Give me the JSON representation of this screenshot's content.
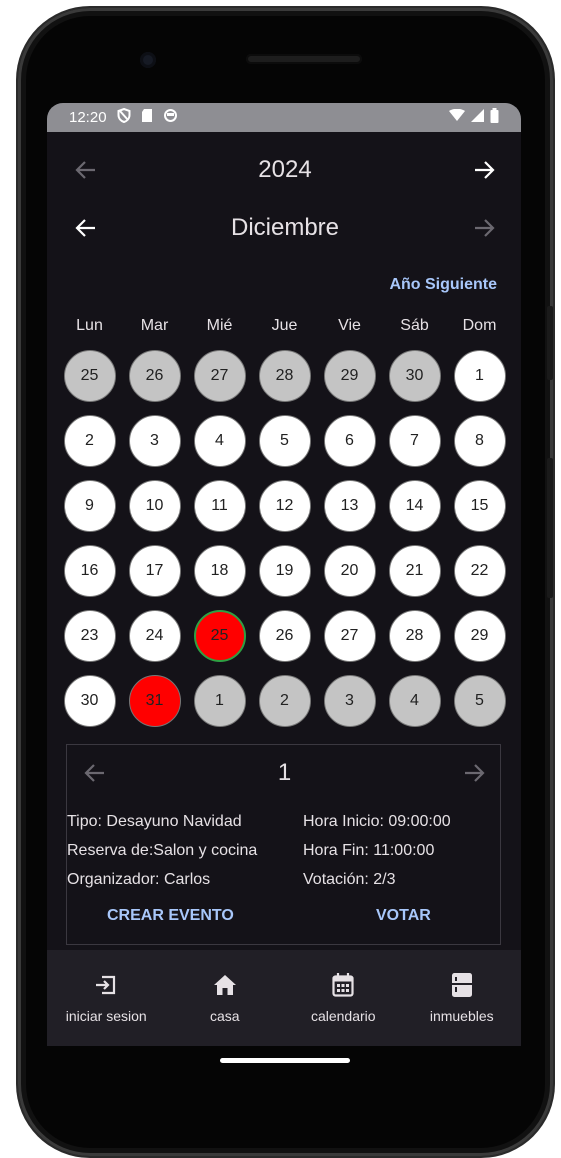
{
  "status": {
    "time": "12:20"
  },
  "year": "2024",
  "month": "Diciembre",
  "next_year_label": "Año Siguiente",
  "weekdays": [
    "Lun",
    "Mar",
    "Mié",
    "Jue",
    "Vie",
    "Sáb",
    "Dom"
  ],
  "days": [
    {
      "d": "25",
      "type": "other"
    },
    {
      "d": "26",
      "type": "other"
    },
    {
      "d": "27",
      "type": "other"
    },
    {
      "d": "28",
      "type": "other"
    },
    {
      "d": "29",
      "type": "other"
    },
    {
      "d": "30",
      "type": "other"
    },
    {
      "d": "1",
      "type": "current"
    },
    {
      "d": "2",
      "type": "current"
    },
    {
      "d": "3",
      "type": "current"
    },
    {
      "d": "4",
      "type": "current"
    },
    {
      "d": "5",
      "type": "current"
    },
    {
      "d": "6",
      "type": "current"
    },
    {
      "d": "7",
      "type": "current"
    },
    {
      "d": "8",
      "type": "current"
    },
    {
      "d": "9",
      "type": "current"
    },
    {
      "d": "10",
      "type": "current"
    },
    {
      "d": "11",
      "type": "current"
    },
    {
      "d": "12",
      "type": "current"
    },
    {
      "d": "13",
      "type": "current"
    },
    {
      "d": "14",
      "type": "current"
    },
    {
      "d": "15",
      "type": "current"
    },
    {
      "d": "16",
      "type": "current"
    },
    {
      "d": "17",
      "type": "current"
    },
    {
      "d": "18",
      "type": "current"
    },
    {
      "d": "19",
      "type": "current"
    },
    {
      "d": "20",
      "type": "current"
    },
    {
      "d": "21",
      "type": "current"
    },
    {
      "d": "22",
      "type": "current"
    },
    {
      "d": "23",
      "type": "current"
    },
    {
      "d": "24",
      "type": "current"
    },
    {
      "d": "25",
      "type": "event-today"
    },
    {
      "d": "26",
      "type": "current"
    },
    {
      "d": "27",
      "type": "current"
    },
    {
      "d": "28",
      "type": "current"
    },
    {
      "d": "29",
      "type": "current"
    },
    {
      "d": "30",
      "type": "current"
    },
    {
      "d": "31",
      "type": "event"
    },
    {
      "d": "1",
      "type": "other"
    },
    {
      "d": "2",
      "type": "other"
    },
    {
      "d": "3",
      "type": "other"
    },
    {
      "d": "4",
      "type": "other"
    },
    {
      "d": "5",
      "type": "other"
    }
  ],
  "event": {
    "index": "1",
    "tipo": "Tipo: Desayuno Navidad",
    "reserva": "Reserva de:Salon y cocina",
    "organizador": "Organizador: Carlos",
    "hora_inicio": "Hora Inicio: 09:00:00",
    "hora_fin": "Hora Fin: 11:00:00",
    "votacion": "Votación: 2/3",
    "create_label": "CREAR EVENTO",
    "vote_label": "VOTAR"
  },
  "bottom_nav": [
    {
      "label": "iniciar sesion",
      "icon": "login-icon"
    },
    {
      "label": "casa",
      "icon": "home-icon"
    },
    {
      "label": "calendario",
      "icon": "calendar-icon"
    },
    {
      "label": "inmuebles",
      "icon": "cabinet-icon"
    }
  ],
  "colors": {
    "event": "#ff0000",
    "other_month": "#c4c4c4",
    "accent": "#a8c7fa",
    "background": "#141218",
    "today_border": "#2ea043"
  }
}
